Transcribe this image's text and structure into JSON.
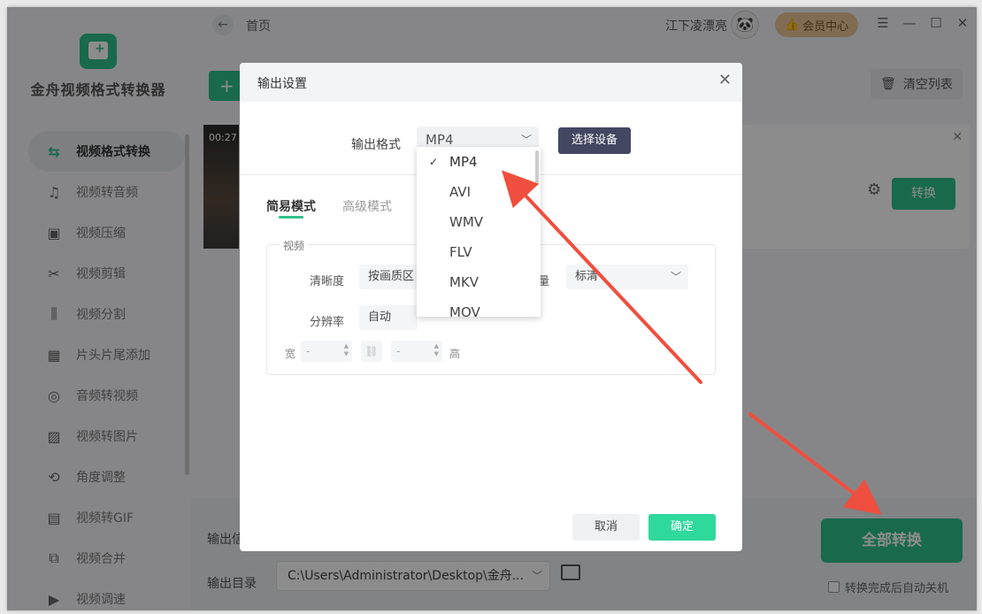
{
  "app": {
    "name": "金舟视频格式转换器"
  },
  "sidebar": {
    "items": [
      {
        "label": "视频格式转换",
        "icon": "format-convert-icon",
        "glyph": "⇆"
      },
      {
        "label": "视频转音频",
        "icon": "music-note-icon",
        "glyph": "♫"
      },
      {
        "label": "视频压缩",
        "icon": "compress-icon",
        "glyph": "▣"
      },
      {
        "label": "视频剪辑",
        "icon": "scissors-icon",
        "glyph": "✂"
      },
      {
        "label": "视频分割",
        "icon": "split-icon",
        "glyph": "⫼"
      },
      {
        "label": "片头片尾添加",
        "icon": "film-strip-icon",
        "glyph": "▦"
      },
      {
        "label": "音频转视频",
        "icon": "disc-icon",
        "glyph": "◎"
      },
      {
        "label": "视频转图片",
        "icon": "image-icon",
        "glyph": "▨"
      },
      {
        "label": "角度调整",
        "icon": "rotate-icon",
        "glyph": "⟲"
      },
      {
        "label": "视频转GIF",
        "icon": "gif-icon",
        "glyph": "▤"
      },
      {
        "label": "视频合并",
        "icon": "merge-icon",
        "glyph": "⧉"
      },
      {
        "label": "视频调速",
        "icon": "speed-icon",
        "glyph": "▶"
      }
    ]
  },
  "topbar": {
    "breadcrumb": "首页",
    "username": "江下凌漂亮",
    "vip_label": "会员中心"
  },
  "main": {
    "clear_label": "清空列表",
    "file_time": "00:27",
    "convert_label": "转换",
    "output_info_label": "输出信",
    "output_dir_label": "输出目录",
    "output_dir_value": "C:\\Users\\Administrator\\Desktop\\金舟...",
    "convert_all_label": "全部转换",
    "shutdown_label": "转换完成后自动关机"
  },
  "dialog": {
    "title": "输出设置",
    "format_label": "输出格式",
    "format_value": "MP4",
    "device_button": "选择设备",
    "tabs": [
      "简易模式",
      "高级模式"
    ],
    "group_title": "视频",
    "clarity_label": "清晰度",
    "clarity_value": "按画质区",
    "quality_label": "量",
    "quality_value": "标清",
    "resolution_label": "分辨率",
    "resolution_value": "自动",
    "width_label": "宽",
    "height_label": "高",
    "width_value": "-",
    "height_value": "-",
    "cancel_label": "取消",
    "ok_label": "确定"
  },
  "dropdown": {
    "options": [
      "MP4",
      "AVI",
      "WMV",
      "FLV",
      "MKV",
      "MOV"
    ],
    "selected": "MP4"
  },
  "colors": {
    "accent": "#2fc08b",
    "arrow": "#f04e3e",
    "device_btn": "#434761"
  }
}
